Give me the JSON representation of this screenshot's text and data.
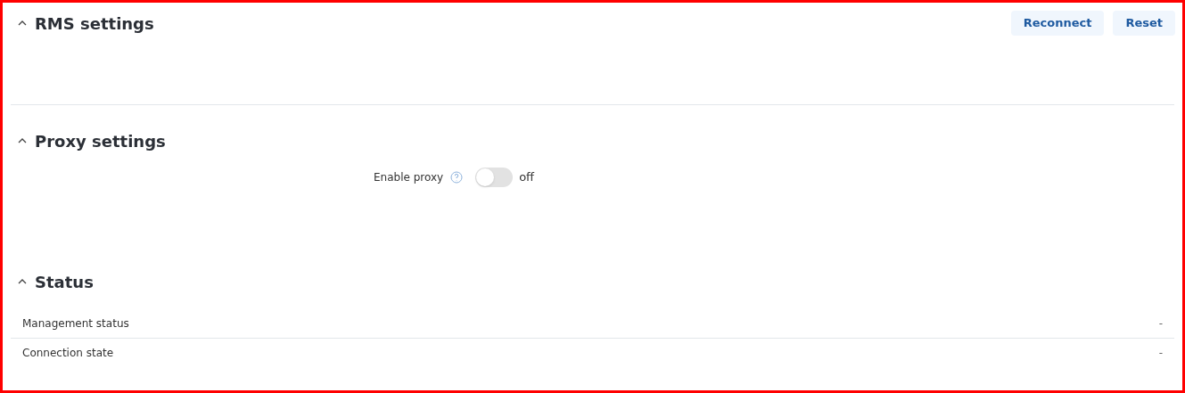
{
  "sections": [
    {
      "title": "RMS settings",
      "expanded": true,
      "buttons": [
        "Reconnect",
        "Reset"
      ]
    },
    {
      "title": "Proxy settings",
      "expanded": true,
      "fields": [
        {
          "label": "Enable proxy",
          "on": false,
          "state_text": "off"
        }
      ]
    },
    {
      "title": "Status",
      "expanded": true,
      "rows": [
        {
          "label": "Management status",
          "value": "-"
        },
        {
          "label": "Connection state",
          "value": "-"
        }
      ]
    }
  ]
}
